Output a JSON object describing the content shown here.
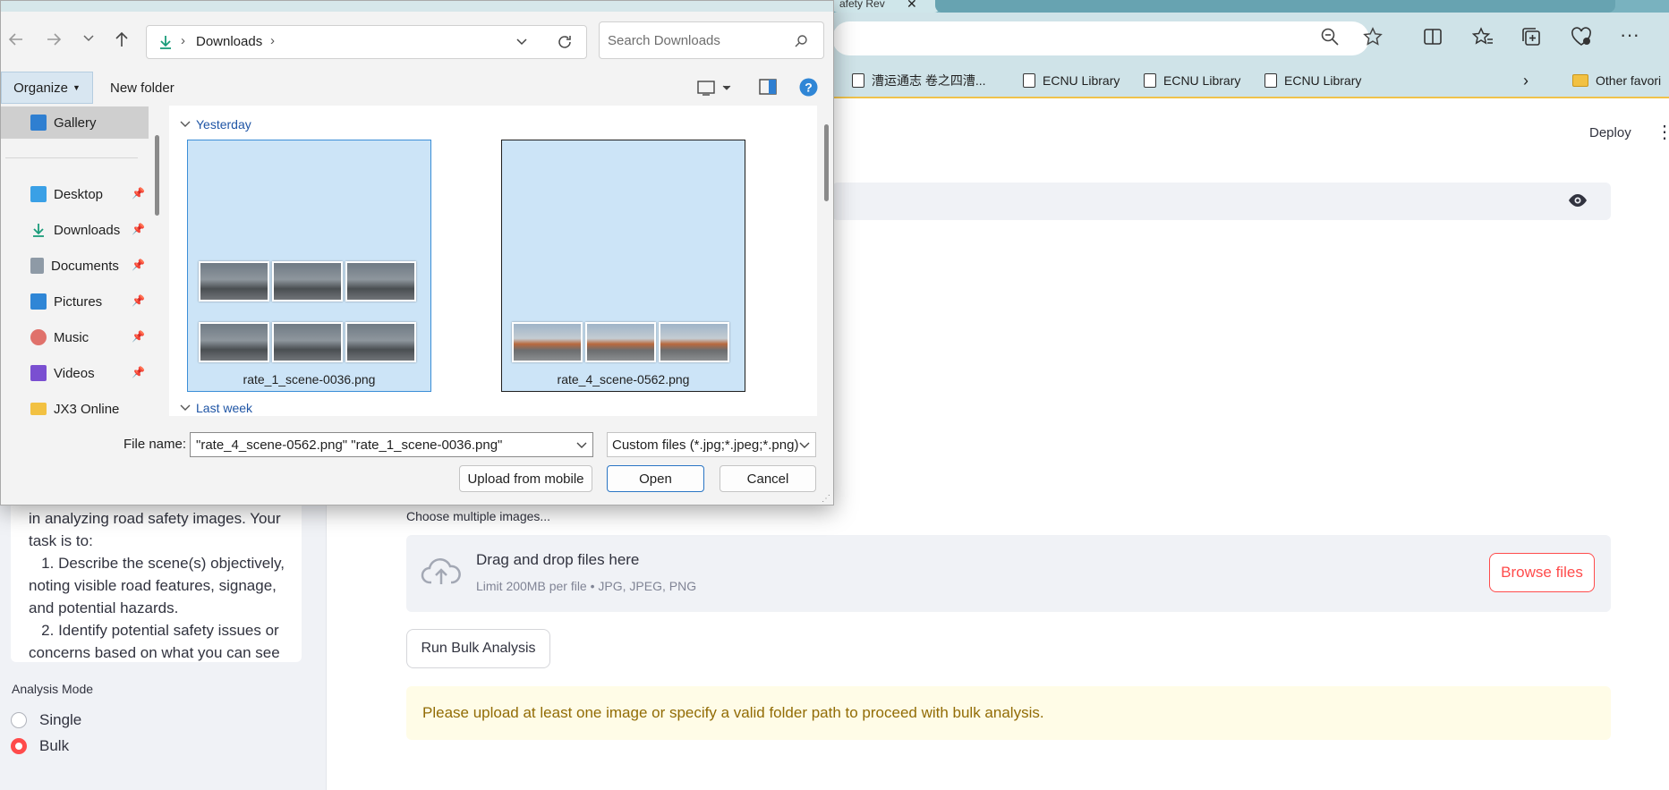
{
  "browser": {
    "tab_fragment": "afety Rev",
    "bookmarks": [
      {
        "label": "漕运通志 卷之四漕..."
      },
      {
        "label": "ECNU Library"
      },
      {
        "label": "ECNU Library"
      },
      {
        "label": "ECNU Library"
      }
    ],
    "other_favorites": "Other favori"
  },
  "app": {
    "deploy_label": "Deploy",
    "prompt_text": "in analyzing road safety images. Your task is to:\n   1. Describe the scene(s) objectively, noting visible road features, signage, and potential hazards.\n   2. Identify potential safety issues or concerns based on what you can see",
    "analysis_mode_label": "Analysis Mode",
    "modes": [
      {
        "label": "Single",
        "selected": false
      },
      {
        "label": "Bulk",
        "selected": true
      }
    ],
    "uploader_label": "Choose multiple images...",
    "dropzone_title": "Drag and drop files here",
    "dropzone_limit": "Limit 200MB per file • JPG, JPEG, PNG",
    "browse_label": "Browse files",
    "run_label": "Run Bulk Analysis",
    "warning_text": "Please upload at least one image or specify a valid folder path to proceed with bulk analysis.",
    "accent_color": "#ff4b4b"
  },
  "dialog": {
    "breadcrumb": "Downloads",
    "search_placeholder": "Search Downloads",
    "organize_label": "Organize",
    "new_folder_label": "New folder",
    "nav_items": [
      {
        "label": "Gallery",
        "icon": "gallery-icon"
      },
      {
        "label": "Desktop",
        "icon": "desktop-icon"
      },
      {
        "label": "Downloads",
        "icon": "download-icon"
      },
      {
        "label": "Documents",
        "icon": "document-icon"
      },
      {
        "label": "Pictures",
        "icon": "pictures-icon"
      },
      {
        "label": "Music",
        "icon": "music-icon"
      },
      {
        "label": "Videos",
        "icon": "videos-icon"
      },
      {
        "label": "JX3 Online",
        "icon": "folder-icon"
      }
    ],
    "groups": [
      "Yesterday",
      "Last week"
    ],
    "files": [
      {
        "name": "rate_1_scene-0036.png"
      },
      {
        "name": "rate_4_scene-0562.png"
      }
    ],
    "filename_label": "File name:",
    "filename_value": "\"rate_4_scene-0562.png\" \"rate_1_scene-0036.png\"",
    "filetype_value": "Custom files (*.jpg;*.jpeg;*.png)",
    "upload_mobile_label": "Upload from mobile",
    "open_label": "Open",
    "cancel_label": "Cancel"
  }
}
